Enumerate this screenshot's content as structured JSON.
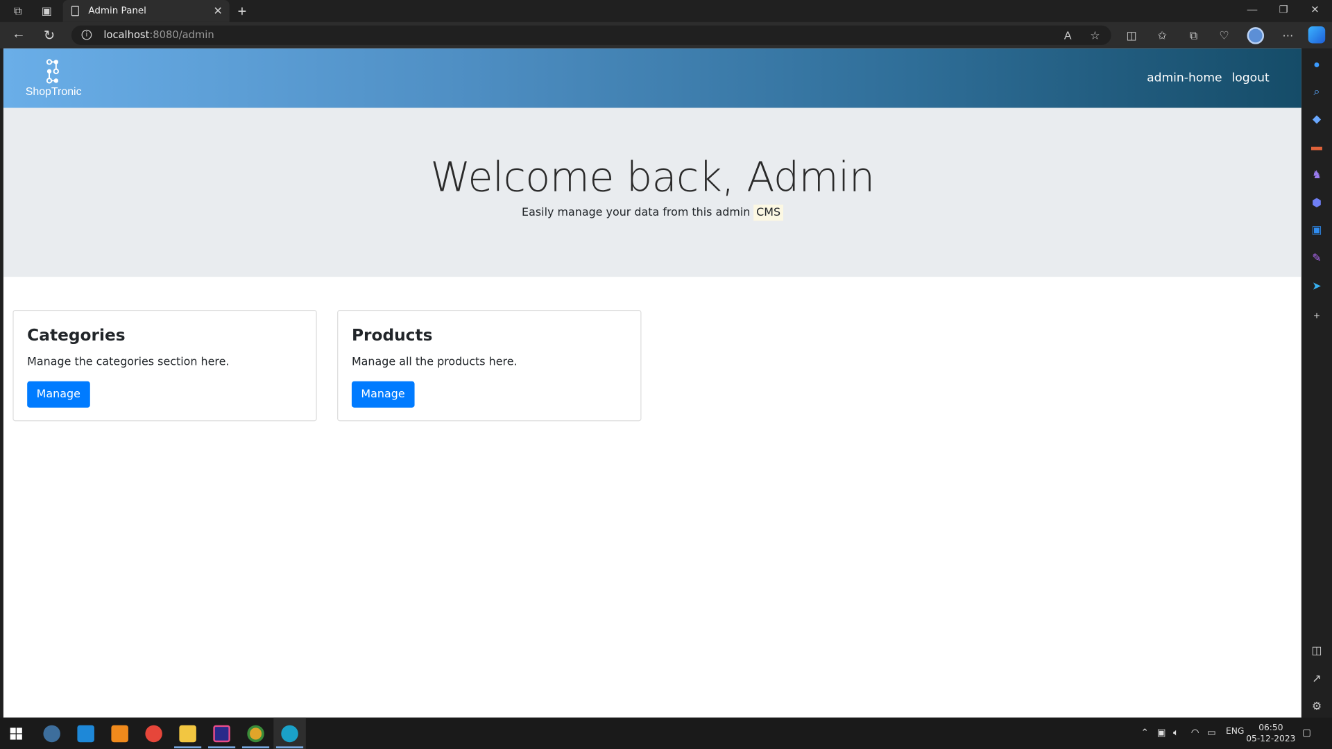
{
  "browser": {
    "tab_title": "Admin Panel",
    "url_host": "localhost",
    "url_rest": ":8080/admin"
  },
  "navbar": {
    "brand": "ShopTronic",
    "links": [
      "admin-home",
      "logout"
    ]
  },
  "hero": {
    "title": "Welcome back, Admin",
    "subtitle_prefix": "Easily manage your data from this admin",
    "subtitle_highlight": "CMS"
  },
  "cards": [
    {
      "title": "Categories",
      "text": "Manage the categories section here.",
      "button": "Manage"
    },
    {
      "title": "Products",
      "text": "Manage all the products here.",
      "button": "Manage"
    }
  ],
  "taskbar": {
    "lang": "ENG",
    "time": "06:50",
    "date": "05-12-2023"
  },
  "colors": {
    "primary_button": "#007bff",
    "navbar_gradient_start": "#6aaee8",
    "navbar_gradient_end": "#154c68",
    "jumbotron_bg": "#e9ecef"
  }
}
